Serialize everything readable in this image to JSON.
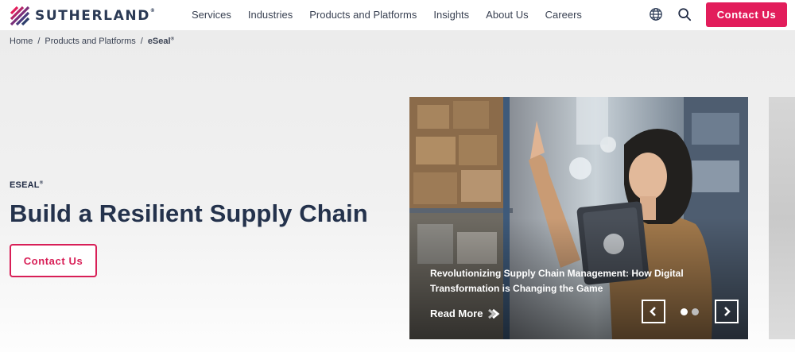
{
  "brand": {
    "name": "SUTHERLAND",
    "reg": "®",
    "accent": "#e21d5b"
  },
  "nav": {
    "items": [
      {
        "label": "Services"
      },
      {
        "label": "Industries"
      },
      {
        "label": "Products and Platforms"
      },
      {
        "label": "Insights"
      },
      {
        "label": "About Us"
      },
      {
        "label": "Careers"
      }
    ],
    "icons": [
      "globe-icon",
      "search-icon"
    ],
    "contact_label": "Contact Us"
  },
  "breadcrumb": {
    "items": [
      "Home",
      "Products and Platforms"
    ],
    "separator": "/",
    "current": "eSeal",
    "current_reg": "®"
  },
  "hero": {
    "eyebrow": "ESEAL",
    "eyebrow_reg": "®",
    "title": "Build a Resilient Supply Chain",
    "cta_label": "Contact Us"
  },
  "carousel": {
    "slide_title": "Revolutionizing Supply Chain Management: How Digital Transformation is Changing the Game",
    "read_more": "Read More",
    "active_slide": 1,
    "slide_count": 2
  }
}
